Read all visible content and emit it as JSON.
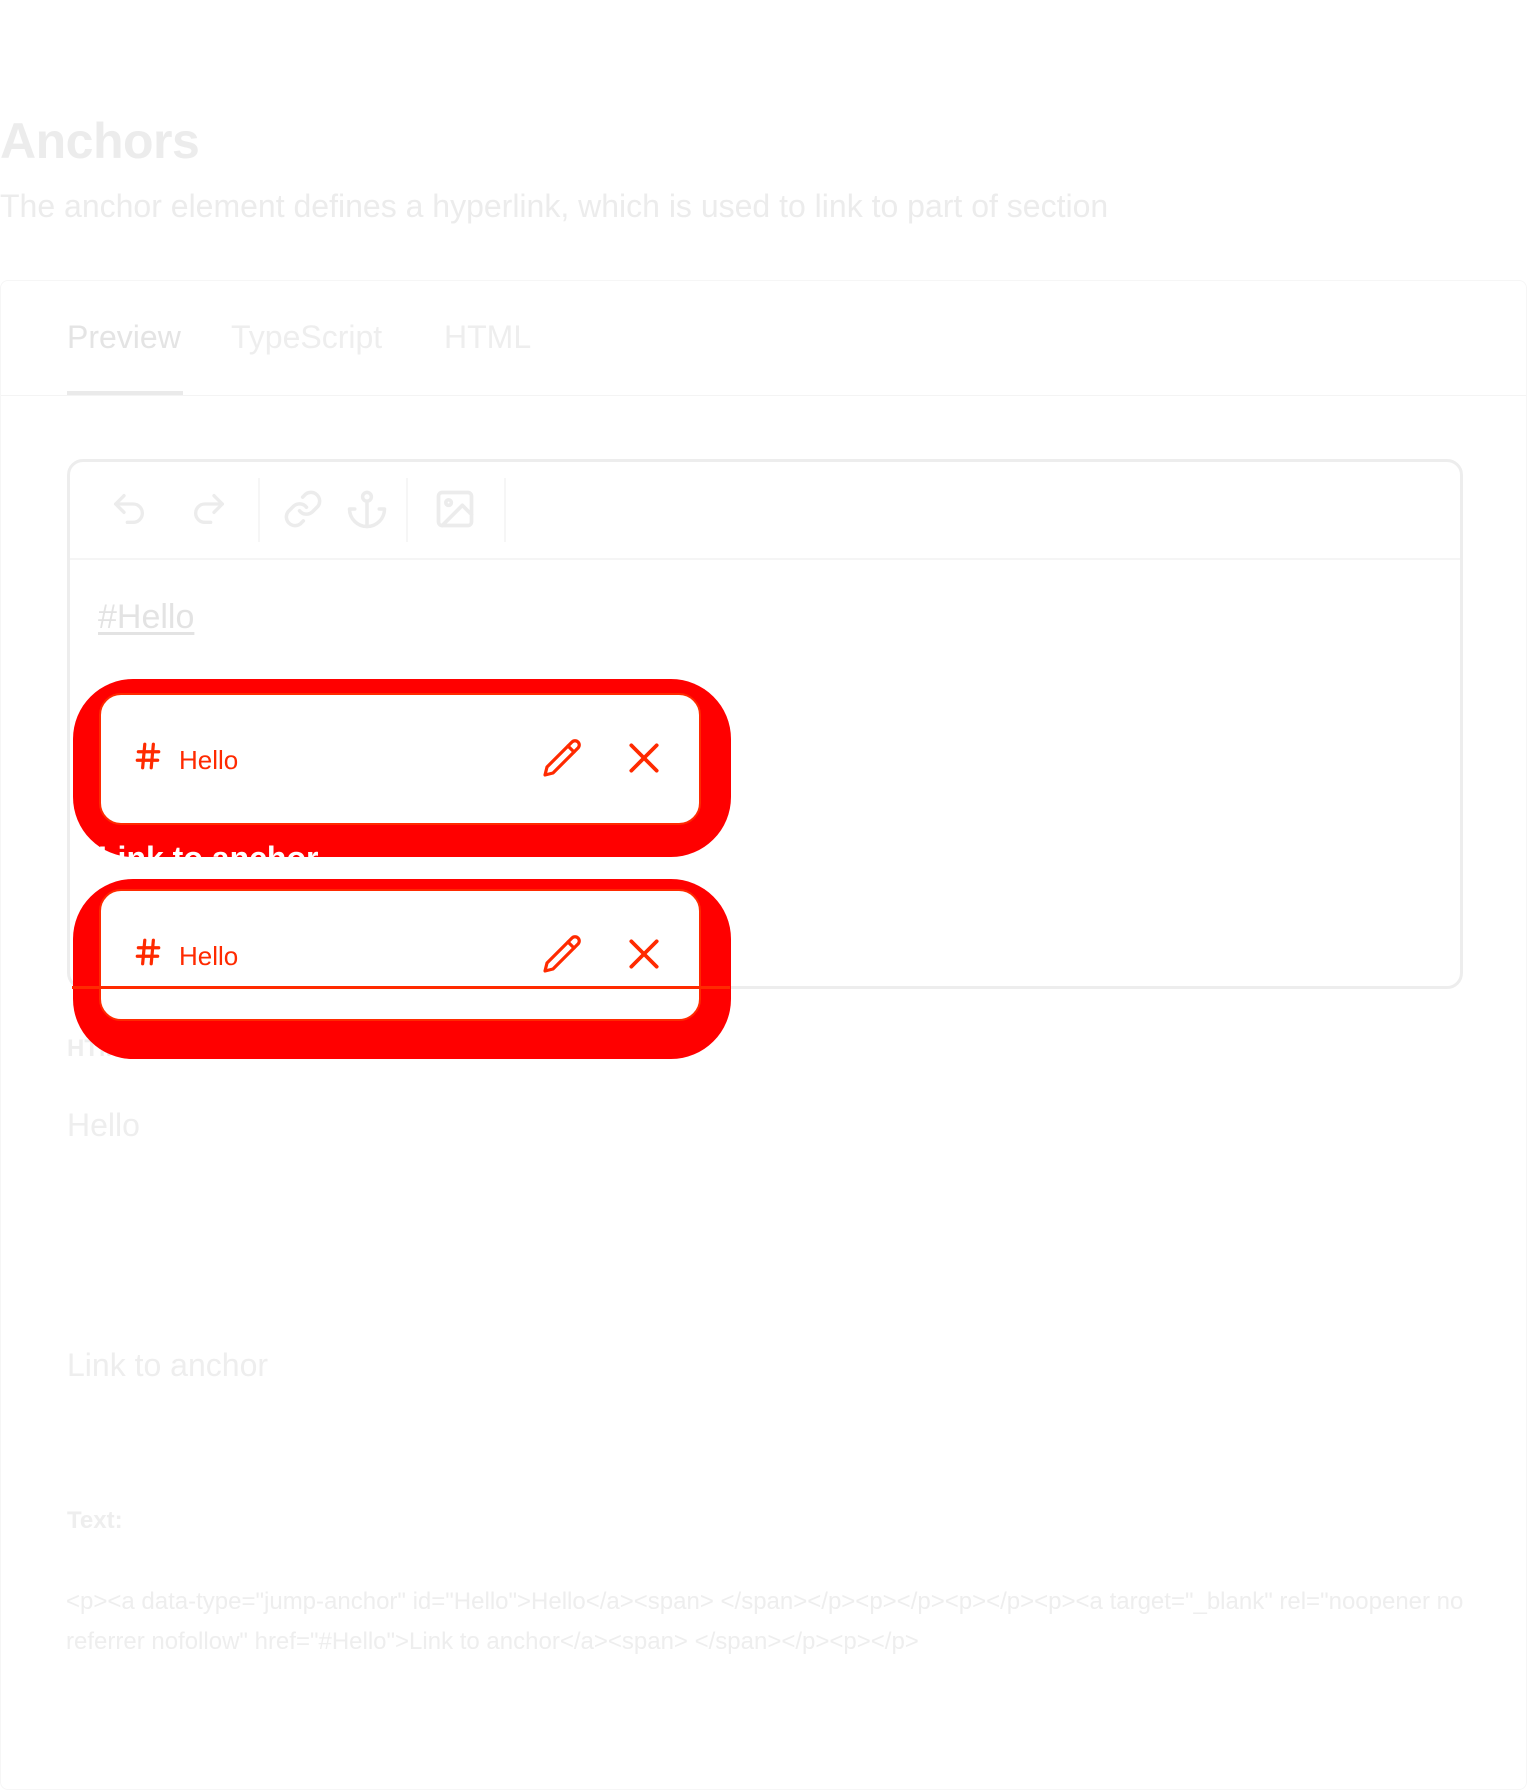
{
  "header": {
    "title": "Anchors",
    "subtitle": "The anchor element defines a hyperlink, which is used to link to part of section"
  },
  "tabs": [
    {
      "label": "Preview",
      "active": true
    },
    {
      "label": "TypeScript",
      "active": false
    },
    {
      "label": "HTML",
      "active": false
    }
  ],
  "toolbar": {
    "icons": [
      "undo-icon",
      "redo-icon",
      "link-icon",
      "anchor-icon",
      "image-icon"
    ]
  },
  "editor": {
    "anchor_text": "#Hello",
    "link_text": "Link to anchor"
  },
  "popups": [
    {
      "label": "Hello"
    },
    {
      "label": "Hello"
    }
  ],
  "output": {
    "html_label": "HTML:",
    "html_line1": "Hello",
    "html_line2": "Link to anchor",
    "text_label": "Text:",
    "text_value": "<p><a data-type=\"jump-anchor\" id=\"Hello\">Hello</a><span> </span></p><p></p><p></p><p><a target=\"_blank\" rel=\"noopener noreferrer nofollow\" href=\"#Hello\">Link to anchor</a><span> </span></p><p></p>"
  },
  "colors": {
    "highlight": "#ff0000",
    "accent": "#ff2a00",
    "faded": "#eeeeee"
  }
}
